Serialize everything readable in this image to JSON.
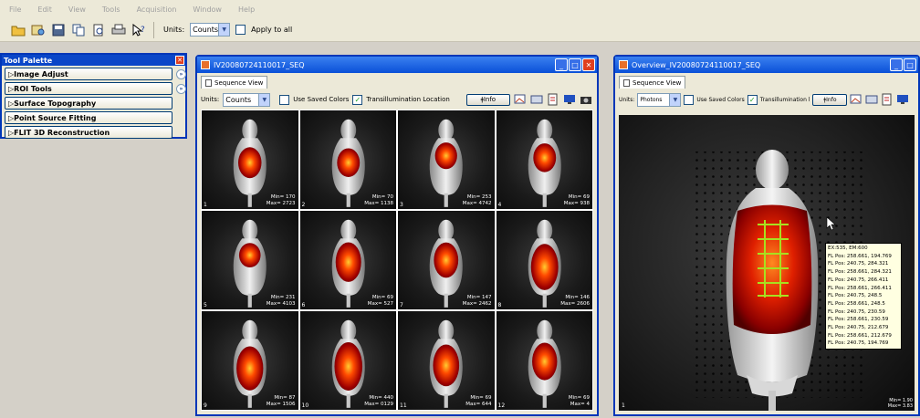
{
  "menu": [
    "File",
    "Edit",
    "View",
    "Tools",
    "Acquisition",
    "Window",
    "Help"
  ],
  "toolbar": {
    "units_label": "Units:",
    "units_value": "Counts",
    "apply_all_label": "Apply to all"
  },
  "palette": {
    "title": "Tool Palette",
    "items": [
      "Image Adjust",
      "ROI Tools",
      "Surface Topography",
      "Point Source Fitting",
      "FLIT 3D Reconstruction"
    ]
  },
  "seq_window": {
    "title": "IV20080724110017_SEQ",
    "tab": "Sequence View",
    "units_label": "Units:",
    "units_value": "Counts",
    "use_saved_colors": "Use Saved Colors",
    "transillum": "Transillumination Location",
    "info_btn": "Info",
    "cells": [
      {
        "num": "1",
        "min": "Min= 170",
        "max": "Max= 2723"
      },
      {
        "num": "2",
        "min": "Min= 70",
        "max": "Max= 1138"
      },
      {
        "num": "3",
        "min": "Min= 253",
        "max": "Max= 4742"
      },
      {
        "num": "4",
        "min": "Min= 69",
        "max": "Max= 938"
      },
      {
        "num": "5",
        "min": "Min= 231",
        "max": "Max= 4103"
      },
      {
        "num": "6",
        "min": "Min= 69",
        "max": "Max= 527"
      },
      {
        "num": "7",
        "min": "Min= 147",
        "max": "Max= 2462"
      },
      {
        "num": "8",
        "min": "Min= 146",
        "max": "Max= 2606"
      },
      {
        "num": "9",
        "min": "Min= 87",
        "max": "Max= 1506"
      },
      {
        "num": "10",
        "min": "Min= 440",
        "max": "Max= 0129"
      },
      {
        "num": "11",
        "min": "Min= 69",
        "max": "Max= 644"
      },
      {
        "num": "12",
        "min": "Min= 69",
        "max": "Max= 4"
      }
    ]
  },
  "ov_window": {
    "title": "Overview_IV20080724110017_SEQ",
    "tab": "Sequence View",
    "units_label": "Units:",
    "units_value": "Photons",
    "use_saved_colors": "Use Saved Colors",
    "transillum": "Transillumination l",
    "info_btn": "Info",
    "num": "1",
    "min": "Min= 1.90",
    "max": "Max= 3.83",
    "tooltip": [
      "EX:535, EM:600",
      "FL Pos: 258.661, 194.769",
      "FL Pos: 240.75, 284.321",
      "FL Pos: 258.661, 284.321",
      "FL Pos: 240.75, 266.411",
      "FL Pos: 258.661, 266.411",
      "FL Pos: 240.75, 248.5",
      "FL Pos: 258.661, 248.5",
      "FL Pos: 240.75, 230.59",
      "FL Pos: 258.661, 230.59",
      "FL Pos: 240.75, 212.679",
      "FL Pos: 258.661, 212.679",
      "FL Pos: 240.75, 194.769"
    ]
  }
}
